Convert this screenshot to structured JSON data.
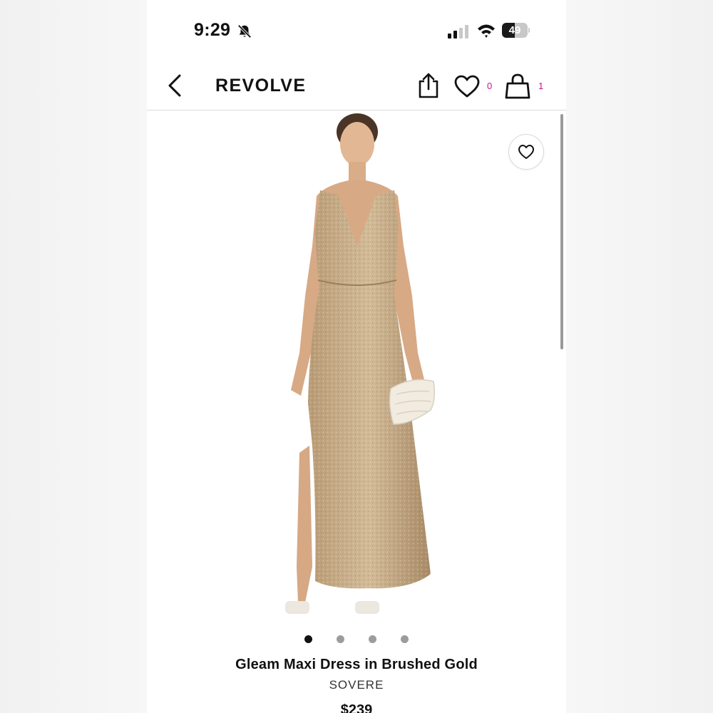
{
  "status_bar": {
    "time": "9:29",
    "battery_level": "49",
    "icons": [
      "bell-slash-icon",
      "signal-icon",
      "wifi-icon",
      "battery-icon"
    ]
  },
  "nav": {
    "brand": "REVOLVE",
    "wishlist_count": "0",
    "bag_count": "1",
    "icons": [
      "chevron-left-icon",
      "share-icon",
      "heart-icon",
      "shopping-bag-icon"
    ],
    "accent_color": "#c2168f"
  },
  "product": {
    "name": "Gleam Maxi Dress in Brushed Gold",
    "brand": "SOVERE",
    "price": "$239",
    "image_count": 4,
    "active_image": 1,
    "image_subject": "model wearing gold sequin V-neck maxi dress holding white clutch"
  }
}
